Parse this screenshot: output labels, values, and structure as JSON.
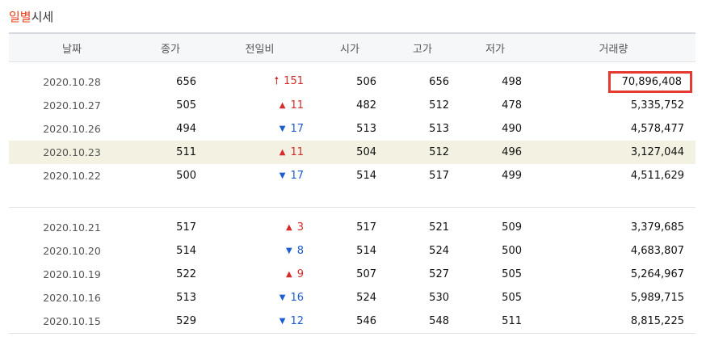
{
  "section_title_accent": "일별",
  "section_title_rest": "시세",
  "headers": {
    "date": "날짜",
    "close": "종가",
    "change": "전일비",
    "open": "시가",
    "high": "고가",
    "low": "저가",
    "volume": "거래량"
  },
  "rows": [
    {
      "date": "2020.10.28",
      "close": "656",
      "dir": "up-strong",
      "arrow": "🠕",
      "change": "151",
      "open": "506",
      "high": "656",
      "low": "498",
      "volume": "70,896,408"
    },
    {
      "date": "2020.10.27",
      "close": "505",
      "dir": "up",
      "arrow": "▲",
      "change": "11",
      "open": "482",
      "high": "512",
      "low": "478",
      "volume": "5,335,752"
    },
    {
      "date": "2020.10.26",
      "close": "494",
      "dir": "down",
      "arrow": "▼",
      "change": "17",
      "open": "513",
      "high": "513",
      "low": "490",
      "volume": "4,578,477"
    },
    {
      "date": "2020.10.23",
      "close": "511",
      "dir": "up",
      "arrow": "▲",
      "change": "11",
      "open": "504",
      "high": "512",
      "low": "496",
      "volume": "3,127,044"
    },
    {
      "date": "2020.10.22",
      "close": "500",
      "dir": "down",
      "arrow": "▼",
      "change": "17",
      "open": "514",
      "high": "517",
      "low": "499",
      "volume": "4,511,629"
    },
    {
      "date": "2020.10.21",
      "close": "517",
      "dir": "up",
      "arrow": "▲",
      "change": "3",
      "open": "517",
      "high": "521",
      "low": "509",
      "volume": "3,379,685"
    },
    {
      "date": "2020.10.20",
      "close": "514",
      "dir": "down",
      "arrow": "▼",
      "change": "8",
      "open": "514",
      "high": "524",
      "low": "500",
      "volume": "4,683,807"
    },
    {
      "date": "2020.10.19",
      "close": "522",
      "dir": "up",
      "arrow": "▲",
      "change": "9",
      "open": "507",
      "high": "527",
      "low": "505",
      "volume": "5,264,967"
    },
    {
      "date": "2020.10.16",
      "close": "513",
      "dir": "down",
      "arrow": "▼",
      "change": "16",
      "open": "524",
      "high": "530",
      "low": "505",
      "volume": "5,989,715"
    },
    {
      "date": "2020.10.15",
      "close": "529",
      "dir": "down",
      "arrow": "▼",
      "change": "12",
      "open": "546",
      "high": "548",
      "low": "511",
      "volume": "8,815,225"
    }
  ],
  "colors": {
    "up": "#d62b2b",
    "down": "#1d5fd1",
    "highlight_row": "#f3f1e2",
    "volume_highlight_border": "#e53a2f",
    "title_accent": "#e8401b"
  }
}
